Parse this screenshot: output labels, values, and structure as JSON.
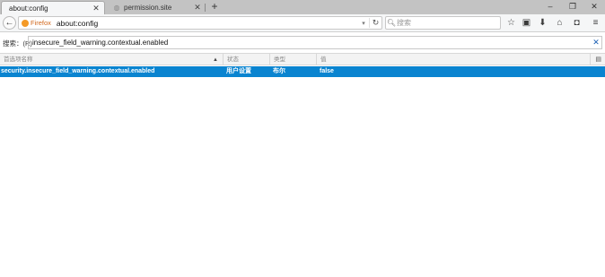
{
  "tabs": [
    {
      "label": "about:config",
      "active": true
    },
    {
      "label": "permission.site",
      "active": false
    }
  ],
  "window_controls": {
    "minimize": "–",
    "restore": "❐",
    "close": "✕"
  },
  "navbar": {
    "identity_label": "Firefox",
    "url": "about:config",
    "search_placeholder": "搜索",
    "icons": [
      "back-icon",
      "reload-icon",
      "bookmark-star-icon",
      "reading-list-icon",
      "download-icon",
      "home-icon",
      "pocket-icon",
      "menu-icon"
    ]
  },
  "filter": {
    "label": "搜索：(R)",
    "value": "insecure_field_warning.contextual.enabled"
  },
  "table": {
    "columns": [
      "首选项名称",
      "状态",
      "类型",
      "值"
    ],
    "rows": [
      {
        "name": "security.insecure_field_warning.contextual.enabled",
        "status": "用户设置",
        "type": "布尔",
        "value": "false",
        "selected": true
      }
    ]
  },
  "colors": {
    "selected_row": "#0a84d0",
    "tab_strip": "#c3c3c3"
  }
}
